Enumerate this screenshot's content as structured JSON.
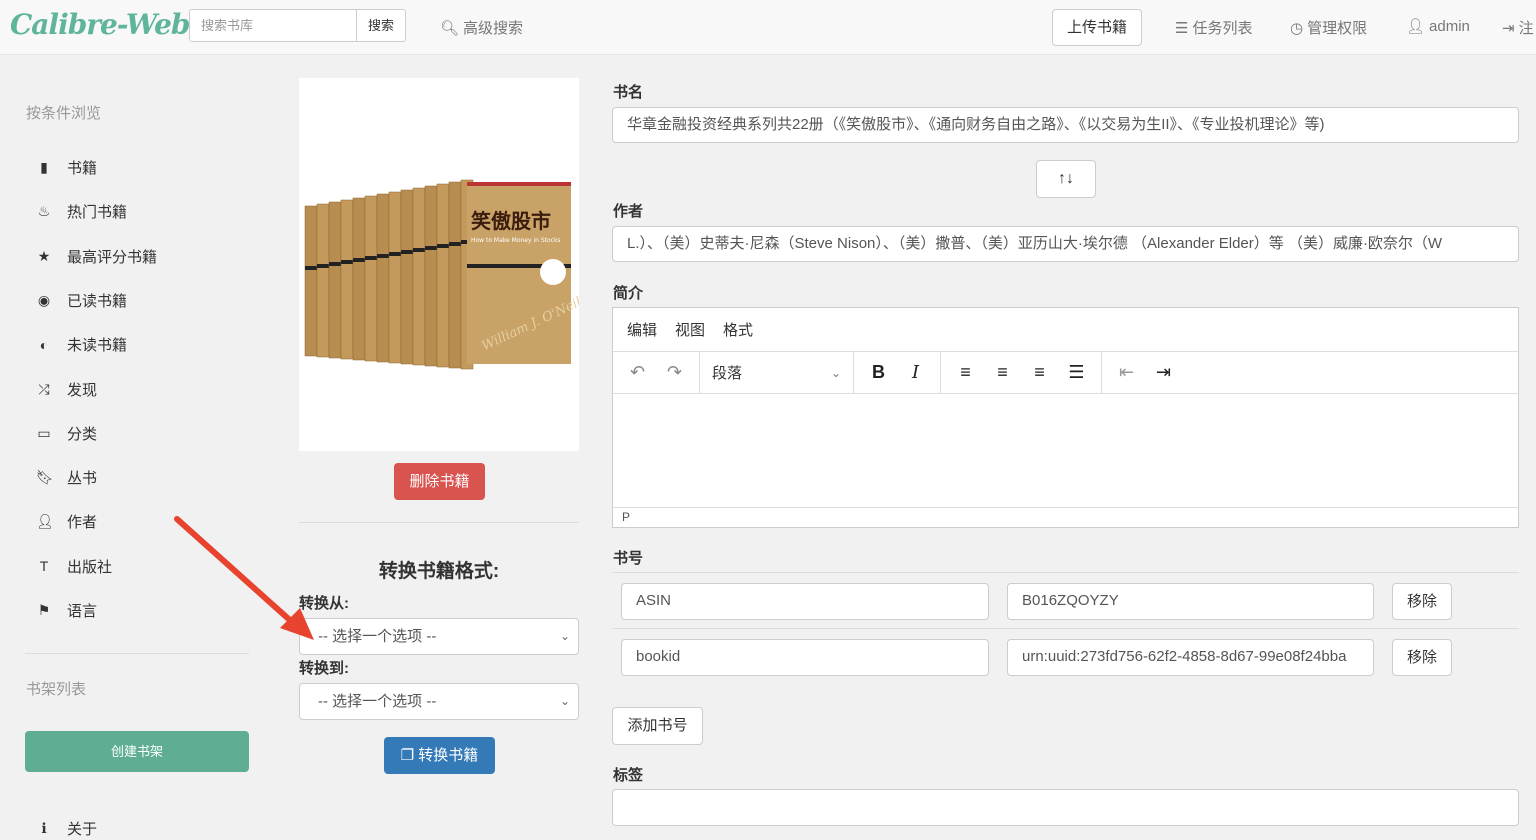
{
  "nav": {
    "logo": "Calibre-Web",
    "search_placeholder": "搜索书库",
    "search_button": "搜索",
    "advanced_search": "高级搜索",
    "upload": "上传书籍",
    "tasks": "任务列表",
    "admin": "管理权限",
    "user": "admin",
    "logout": "注"
  },
  "sidebar": {
    "browse_heading": "按条件浏览",
    "items": [
      {
        "label": "书籍",
        "icon": "book-icon"
      },
      {
        "label": "热门书籍",
        "icon": "fire-icon"
      },
      {
        "label": "最高评分书籍",
        "icon": "star-icon"
      },
      {
        "label": "已读书籍",
        "icon": "eye-icon"
      },
      {
        "label": "未读书籍",
        "icon": "eye-slash-icon"
      },
      {
        "label": "发现",
        "icon": "random-icon"
      },
      {
        "label": "分类",
        "icon": "inbox-icon"
      },
      {
        "label": "丛书",
        "icon": "bookmark-icon"
      },
      {
        "label": "作者",
        "icon": "user-icon"
      },
      {
        "label": "出版社",
        "icon": "text-size-icon"
      },
      {
        "label": "语言",
        "icon": "flag-icon"
      }
    ],
    "shelf_heading": "书架列表",
    "create_shelf": "创建书架",
    "about": "关于"
  },
  "book": {
    "cover_title": "笑傲股市",
    "cover_subtitle": "How to Make Money in Stocks",
    "cover_author": "William J. O'Neil",
    "delete": "删除书籍"
  },
  "convert": {
    "heading": "转换书籍格式:",
    "from_label": "转换从:",
    "from_value": "-- 选择一个选项 --",
    "to_label": "转换到:",
    "to_value": "-- 选择一个选项 --",
    "button": "转换书籍"
  },
  "form": {
    "title_label": "书名",
    "title_value": "华章金融投资经典系列共22册（《笑傲股市》、《通向财务自由之路》、《以交易为生II》、《专业投机理论》等)",
    "author_label": "作者",
    "author_value": "L.）、（美）史蒂夫·尼森（Steve Nison）、（美）撒普、（美）亚历山大·埃尔德 （Alexander Elder）等 （美）威廉·欧奈尔（W",
    "desc_label": "简介",
    "editor_menu": [
      "编辑",
      "视图",
      "格式"
    ],
    "block_format": "段落",
    "status_path": "P",
    "identifiers_label": "书号",
    "identifiers": [
      {
        "type": "ASIN",
        "value": "B016ZQOYZY",
        "remove": "移除"
      },
      {
        "type": "bookid",
        "value": "urn:uuid:273fd756-62f2-4858-8d67-99e08f24bba",
        "remove": "移除"
      }
    ],
    "add_identifier": "添加书号",
    "tags_label": "标签",
    "tags_value": ""
  }
}
